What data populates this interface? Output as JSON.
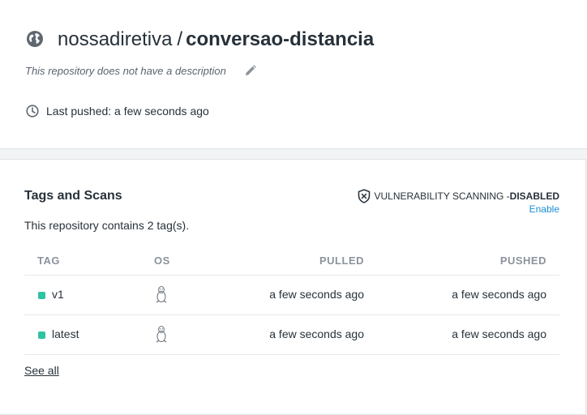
{
  "repo": {
    "namespace": "nossadiretiva",
    "separator": "/",
    "name": "conversao-distancia",
    "description": "This repository does not have a description",
    "last_pushed": "Last pushed: a few seconds ago"
  },
  "tags_section": {
    "title": "Tags and Scans",
    "vuln_label": "VULNERABILITY SCANNING - ",
    "vuln_status": "DISABLED",
    "enable_label": "Enable",
    "tag_count_text": "This repository contains 2 tag(s).",
    "columns": {
      "tag": "TAG",
      "os": "OS",
      "pulled": "PULLED",
      "pushed": "PUSHED"
    },
    "rows": [
      {
        "tag": "v1",
        "os_icon": "linux-icon",
        "pulled": "a few seconds ago",
        "pushed": "a few seconds ago"
      },
      {
        "tag": "latest",
        "os_icon": "linux-icon",
        "pulled": "a few seconds ago",
        "pushed": "a few seconds ago"
      }
    ],
    "see_all": "See all"
  },
  "colors": {
    "accent_link": "#1a8ed4",
    "tag_dot": "#2ec3a1",
    "text": "#27313a",
    "muted": "#8b939c"
  },
  "icons": [
    "globe-icon",
    "pencil-icon",
    "clock-icon",
    "shield-icon",
    "linux-icon"
  ]
}
